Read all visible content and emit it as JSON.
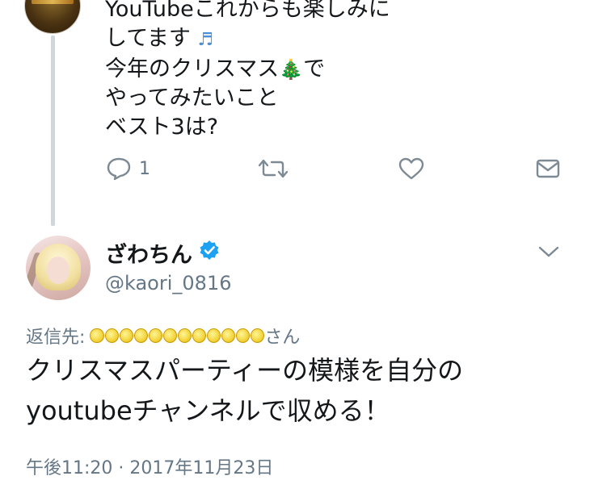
{
  "parent_tweet": {
    "lines": [
      "YouTubeこれからも楽しみに",
      "してます",
      "今年のクリスマス",
      "でやってみたいこと",
      "ベスト3は?"
    ],
    "line1": "YouTubeこれからも楽しみに",
    "line2": "してます",
    "line3a": "今年のクリスマス",
    "line3b": "で",
    "line4": "やってみたいこと",
    "line5": "ベスト3は?",
    "notes_emoji": "♬",
    "tree_emoji": "🎄",
    "actions": {
      "reply_count": "1",
      "reply_icon": "reply-icon",
      "retweet_icon": "retweet-icon",
      "like_icon": "heart-icon",
      "dm_icon": "envelope-icon"
    }
  },
  "reply_tweet": {
    "display_name": "ざわちん",
    "handle": "@kaori_0816",
    "reply_to_label": "返信先:",
    "reply_to_suffix": "さん",
    "body_line1": "クリスマスパーティーの模様を自分の",
    "body_line2": "youtubeチャンネルで収める！",
    "timestamp": "午後11:20 · 2017年11月23日"
  },
  "colors": {
    "text": "#14171a",
    "secondary": "#657786",
    "link": "#1da1f2",
    "verified": "#1da1f2",
    "thread_line": "#cfd6dc"
  }
}
